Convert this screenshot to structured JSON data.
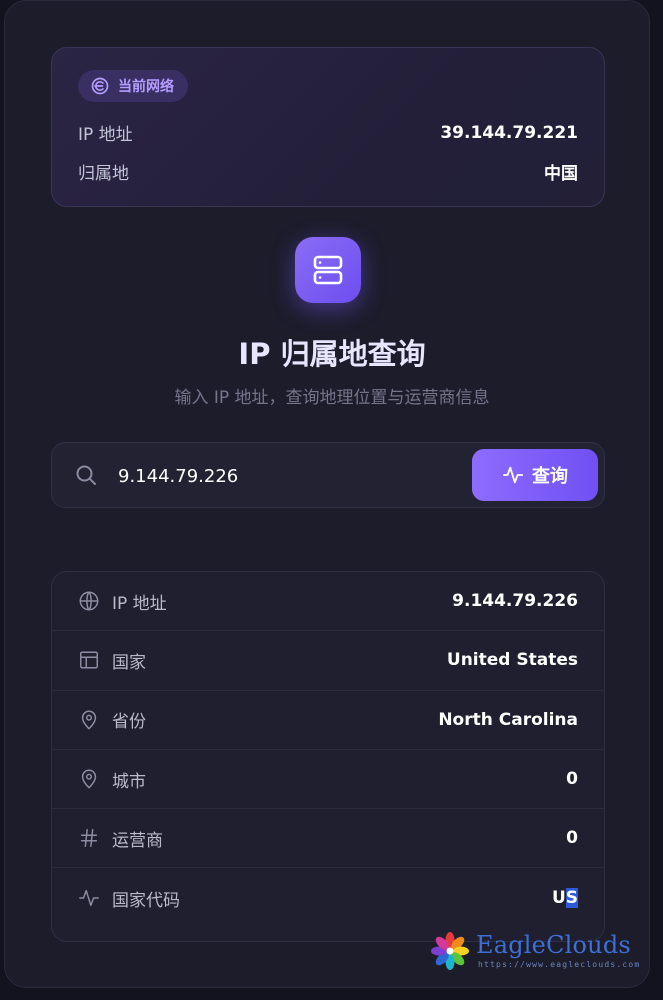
{
  "current_network": {
    "badge_label": "当前网络",
    "ip_label": "IP 地址",
    "ip_value": "39.144.79.221",
    "location_label": "归属地",
    "location_value": "中国"
  },
  "hero": {
    "icon": "server-icon",
    "title": "IP 归属地查询",
    "subtitle": "输入 IP 地址，查询地理位置与运营商信息"
  },
  "search": {
    "value": "9.144.79.226",
    "button_label": "查询"
  },
  "result": {
    "rows": [
      {
        "icon": "globe-icon",
        "label": "IP 地址",
        "value": "9.144.79.226"
      },
      {
        "icon": "layout-icon",
        "label": "国家",
        "value": "United States"
      },
      {
        "icon": "map-pin-icon",
        "label": "省份",
        "value": "North Carolina"
      },
      {
        "icon": "map-pin-icon",
        "label": "城市",
        "value": "0"
      },
      {
        "icon": "hash-icon",
        "label": "运营商",
        "value": "0"
      },
      {
        "icon": "activity-icon",
        "label": "国家代码",
        "value_prefix": "U",
        "value_highlight": "S"
      }
    ]
  },
  "watermark": {
    "brand": "EagleClouds",
    "url": "https://www.eagleclouds.com"
  },
  "colors": {
    "accent": "#7c5cff",
    "background": "#1c1c2b",
    "card": "#1f1f30"
  }
}
